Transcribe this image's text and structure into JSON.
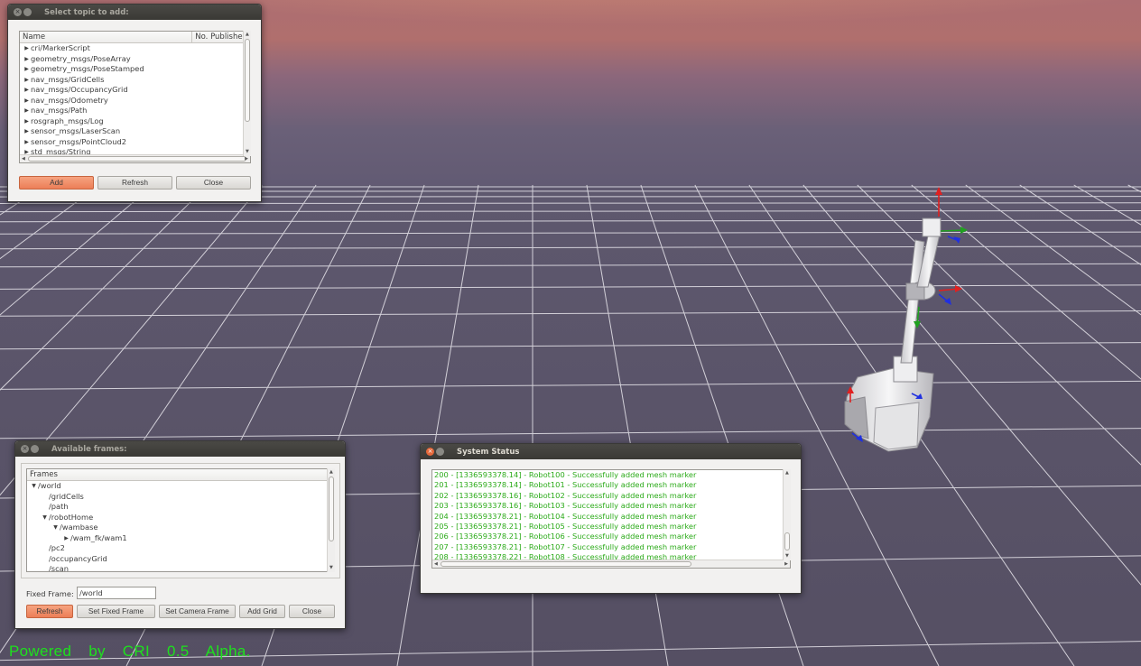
{
  "topic_dialog": {
    "title": "Select topic to add:",
    "columns": [
      "Name",
      "No. Publisher"
    ],
    "topics": [
      "cri/MarkerScript",
      "geometry_msgs/PoseArray",
      "geometry_msgs/PoseStamped",
      "nav_msgs/GridCells",
      "nav_msgs/OccupancyGrid",
      "nav_msgs/Odometry",
      "nav_msgs/Path",
      "rosgraph_msgs/Log",
      "sensor_msgs/LaserScan",
      "sensor_msgs/PointCloud2",
      "std_msgs/String"
    ],
    "buttons": {
      "add": "Add",
      "refresh": "Refresh",
      "close": "Close"
    }
  },
  "frames_dialog": {
    "title": "Available frames:",
    "column": "Frames",
    "frames": [
      {
        "label": "/world",
        "expanded": true
      },
      {
        "label": "/gridCells",
        "expanded": null
      },
      {
        "label": "/path",
        "expanded": null
      },
      {
        "label": "/robotHome",
        "expanded": true
      },
      {
        "label": "/wambase",
        "expanded": true
      },
      {
        "label": "/wam_fk/wam1",
        "expanded": false
      },
      {
        "label": "/pc2",
        "expanded": null
      },
      {
        "label": "/occupancyGrid",
        "expanded": null
      },
      {
        "label": "/scan",
        "expanded": null
      }
    ],
    "fixed_frame_label": "Fixed Frame:",
    "fixed_frame_value": "/world",
    "buttons": {
      "refresh": "Refresh",
      "set_fixed_frame": "Set Fixed Frame",
      "set_camera_frame": "Set Camera Frame",
      "add_grid": "Add Grid",
      "close": "Close"
    }
  },
  "status_dialog": {
    "title": "System Status",
    "messages": [
      "200 - [1336593378.14] - Robot100 - Successfully added mesh marker",
      "201 - [1336593378.14] - Robot101 - Successfully added mesh marker",
      "202 - [1336593378.16] - Robot102 - Successfully added mesh marker",
      "203 - [1336593378.16] - Robot103 - Successfully added mesh marker",
      "204 - [1336593378.21] - Robot104 - Successfully added mesh marker",
      "205 - [1336593378.21] - Robot105 - Successfully added mesh marker",
      "206 - [1336593378.21] - Robot106 - Successfully added mesh marker",
      "207 - [1336593378.21] - Robot107 - Successfully added mesh marker",
      "208 - [1336593378.22] - Robot108 - Successfully added mesh marker"
    ]
  },
  "footer": {
    "text": "Powered by CRI 0.5 Alpha."
  },
  "colors": {
    "accent": "#ec7e57",
    "status_text": "#2cab1a",
    "footer_text": "#1ee01e",
    "ground": "#5a5469",
    "grid_line": "#e8e6ec"
  }
}
